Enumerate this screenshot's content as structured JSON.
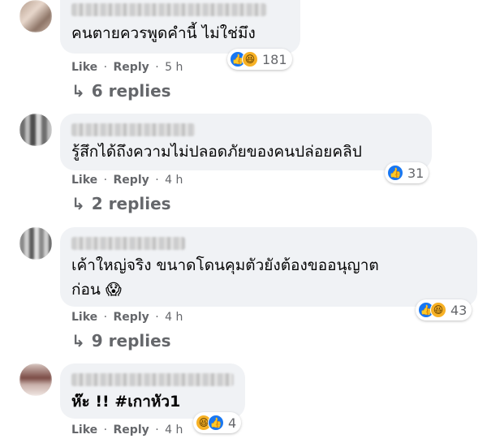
{
  "comments": [
    {
      "text": "คนตายควรพูดคำนี้ ไม่ใช่มึง",
      "actions": {
        "like": "Like",
        "reply": "Reply",
        "sep": "·",
        "time": "5 h"
      },
      "reactions": {
        "icons": [
          "like-icon",
          "haha-icon"
        ],
        "count": "181"
      },
      "replies": "6 replies"
    },
    {
      "text": "รู้สึกได้ถึงความไม่ปลอดภัยของคนปล่อยคลิป",
      "actions": {
        "like": "Like",
        "reply": "Reply",
        "sep": "·",
        "time": "4 h"
      },
      "reactions": {
        "icons": [
          "like-icon"
        ],
        "count": "31"
      },
      "replies": "2 replies"
    },
    {
      "text": "เค้าใหญ่จริง ขนาดโดนคุมตัวยังต้องขออนุญาต\nก่อน 😱",
      "actions": {
        "like": "Like",
        "reply": "Reply",
        "sep": "·",
        "time": "4 h"
      },
      "reactions": {
        "icons": [
          "like-icon",
          "haha-icon"
        ],
        "count": "43"
      },
      "replies": "9 replies"
    },
    {
      "text": "ห๊ะ !! #เกาหัว1",
      "actions": {
        "like": "Like",
        "reply": "Reply",
        "sep": "·",
        "time": "4 h"
      },
      "reactions": {
        "icons": [
          "haha-icon",
          "like-icon"
        ],
        "count": "4"
      }
    }
  ],
  "colors": {
    "like": "#1877f2",
    "haha": "#f7b125",
    "bubble": "#f0f2f5",
    "meta": "#65676b"
  }
}
